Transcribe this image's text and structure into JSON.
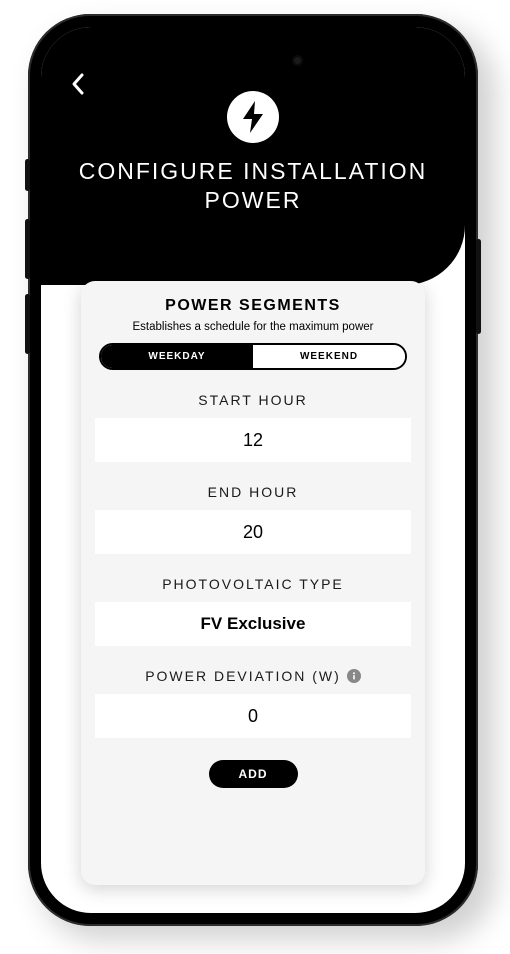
{
  "header": {
    "title": "CONFIGURE INSTALLATION POWER",
    "icon": "bolt-icon"
  },
  "card": {
    "title": "POWER SEGMENTS",
    "subtitle": "Establishes a schedule for the maximum power",
    "toggle": {
      "weekday_label": "WEEKDAY",
      "weekend_label": "WEEKEND",
      "active": "weekday"
    },
    "fields": {
      "start_hour": {
        "label": "START HOUR",
        "value": "12"
      },
      "end_hour": {
        "label": "END HOUR",
        "value": "20"
      },
      "pv_type": {
        "label": "PHOTOVOLTAIC TYPE",
        "value": "FV Exclusive"
      },
      "power_deviation": {
        "label": "POWER DEVIATION (W)",
        "value": "0"
      }
    },
    "add_label": "ADD"
  }
}
